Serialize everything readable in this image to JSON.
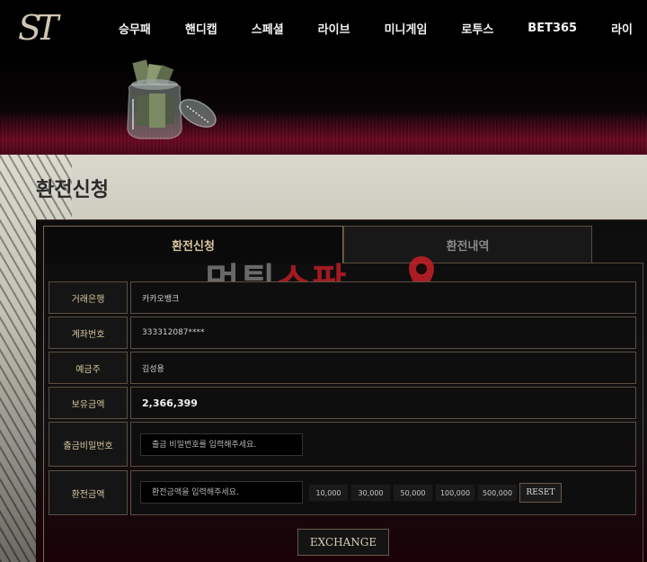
{
  "header": {
    "logo_text": "ST",
    "nav": [
      "승무패",
      "핸디캡",
      "스페셜",
      "라이브",
      "미니게임",
      "로투스",
      "BET365",
      "라이"
    ]
  },
  "page": {
    "title": "환전신청"
  },
  "tabs": [
    {
      "label": "환전신청",
      "active": true
    },
    {
      "label": "환전내역",
      "active": false
    }
  ],
  "watermark": {
    "part1": "먹튀",
    "part2": "스팟"
  },
  "form": {
    "bank_label": "거래은행",
    "bank_value": "카카오뱅크",
    "account_label": "계좌번호",
    "account_value": "333312087****",
    "holder_label": "예금주",
    "holder_value": "김성용",
    "balance_label": "보유금액",
    "balance_value": "2,366,399",
    "password_label": "출금비밀번호",
    "password_placeholder": "출금 비밀번호를 입력해주세요.",
    "amount_label": "환전금액",
    "amount_placeholder": "환전금액을 입력해주세요.",
    "amount_buttons": [
      "10,000",
      "30,000",
      "50,000",
      "100,000",
      "500,000"
    ],
    "reset_label": "RESET"
  },
  "submit": {
    "label": "EXCHANGE"
  },
  "colors": {
    "accent_gold": "#d6c6a0",
    "banner_red": "#6a0a22",
    "watermark_red": "#c81e28"
  }
}
